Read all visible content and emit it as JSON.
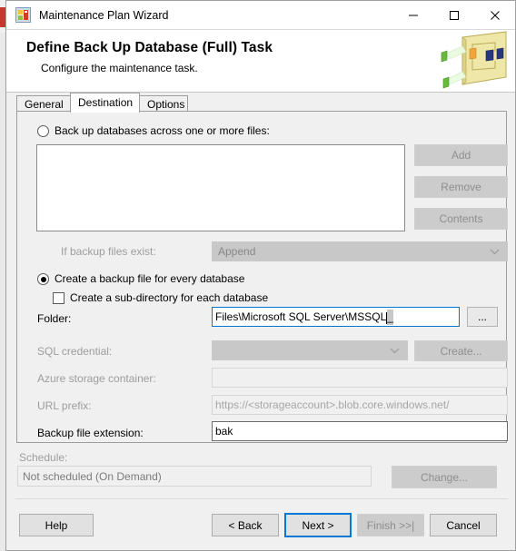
{
  "window": {
    "title": "Maintenance Plan Wizard",
    "icon": "maintenance-plan-icon",
    "minimize_label": "–",
    "maximize_label": "□",
    "close_label": "✕"
  },
  "header": {
    "title": "Define Back Up Database (Full) Task",
    "subtitle": "Configure the maintenance task.",
    "art": "maintenance-plan-designer-graphic"
  },
  "tabs": [
    {
      "label": "General",
      "selected": false
    },
    {
      "label": "Destination",
      "selected": true
    },
    {
      "label": "Options",
      "selected": false
    }
  ],
  "destination": {
    "across_files_radio": {
      "label": "Back up databases across one or more files:",
      "checked": false
    },
    "file_list": {
      "items": []
    },
    "side_buttons": [
      {
        "label": "Add",
        "enabled": false
      },
      {
        "label": "Remove",
        "enabled": false
      },
      {
        "label": "Contents",
        "enabled": false
      }
    ],
    "if_backup_files_exist": {
      "label": "If backup files exist:",
      "value": "Append",
      "enabled": false
    },
    "every_db_radio": {
      "label": "Create a backup file for every database",
      "checked": true
    },
    "sub_directory_checkbox": {
      "label": "Create a sub-directory for each database",
      "checked": false
    },
    "folder": {
      "label": "Folder:",
      "value_visible": "Files\\Microsoft SQL Server\\MSSQL",
      "selected_text": "    _    ",
      "browse_label": "..."
    },
    "sql_credential": {
      "label": "SQL credential:",
      "value": "",
      "create_label": "Create...",
      "enabled": false
    },
    "azure_storage_container": {
      "label": "Azure storage container:",
      "value": "",
      "enabled": false
    },
    "url_prefix": {
      "label": "URL prefix:",
      "value": "https://<storageaccount>.blob.core.windows.net/",
      "enabled": false
    },
    "backup_file_extension": {
      "label": "Backup file extension:",
      "value": "bak",
      "enabled": true
    }
  },
  "schedule": {
    "label": "Schedule:",
    "value": "Not scheduled (On Demand)",
    "change_label": "Change...",
    "enabled": false
  },
  "footer": {
    "help": "Help",
    "back": "< Back",
    "next": "Next >",
    "finish": "Finish >>|",
    "cancel": "Cancel"
  },
  "colors": {
    "accent": "#0078d7",
    "dialog_bg": "#f0f0f0",
    "disabled_text": "#9d9d9d"
  }
}
